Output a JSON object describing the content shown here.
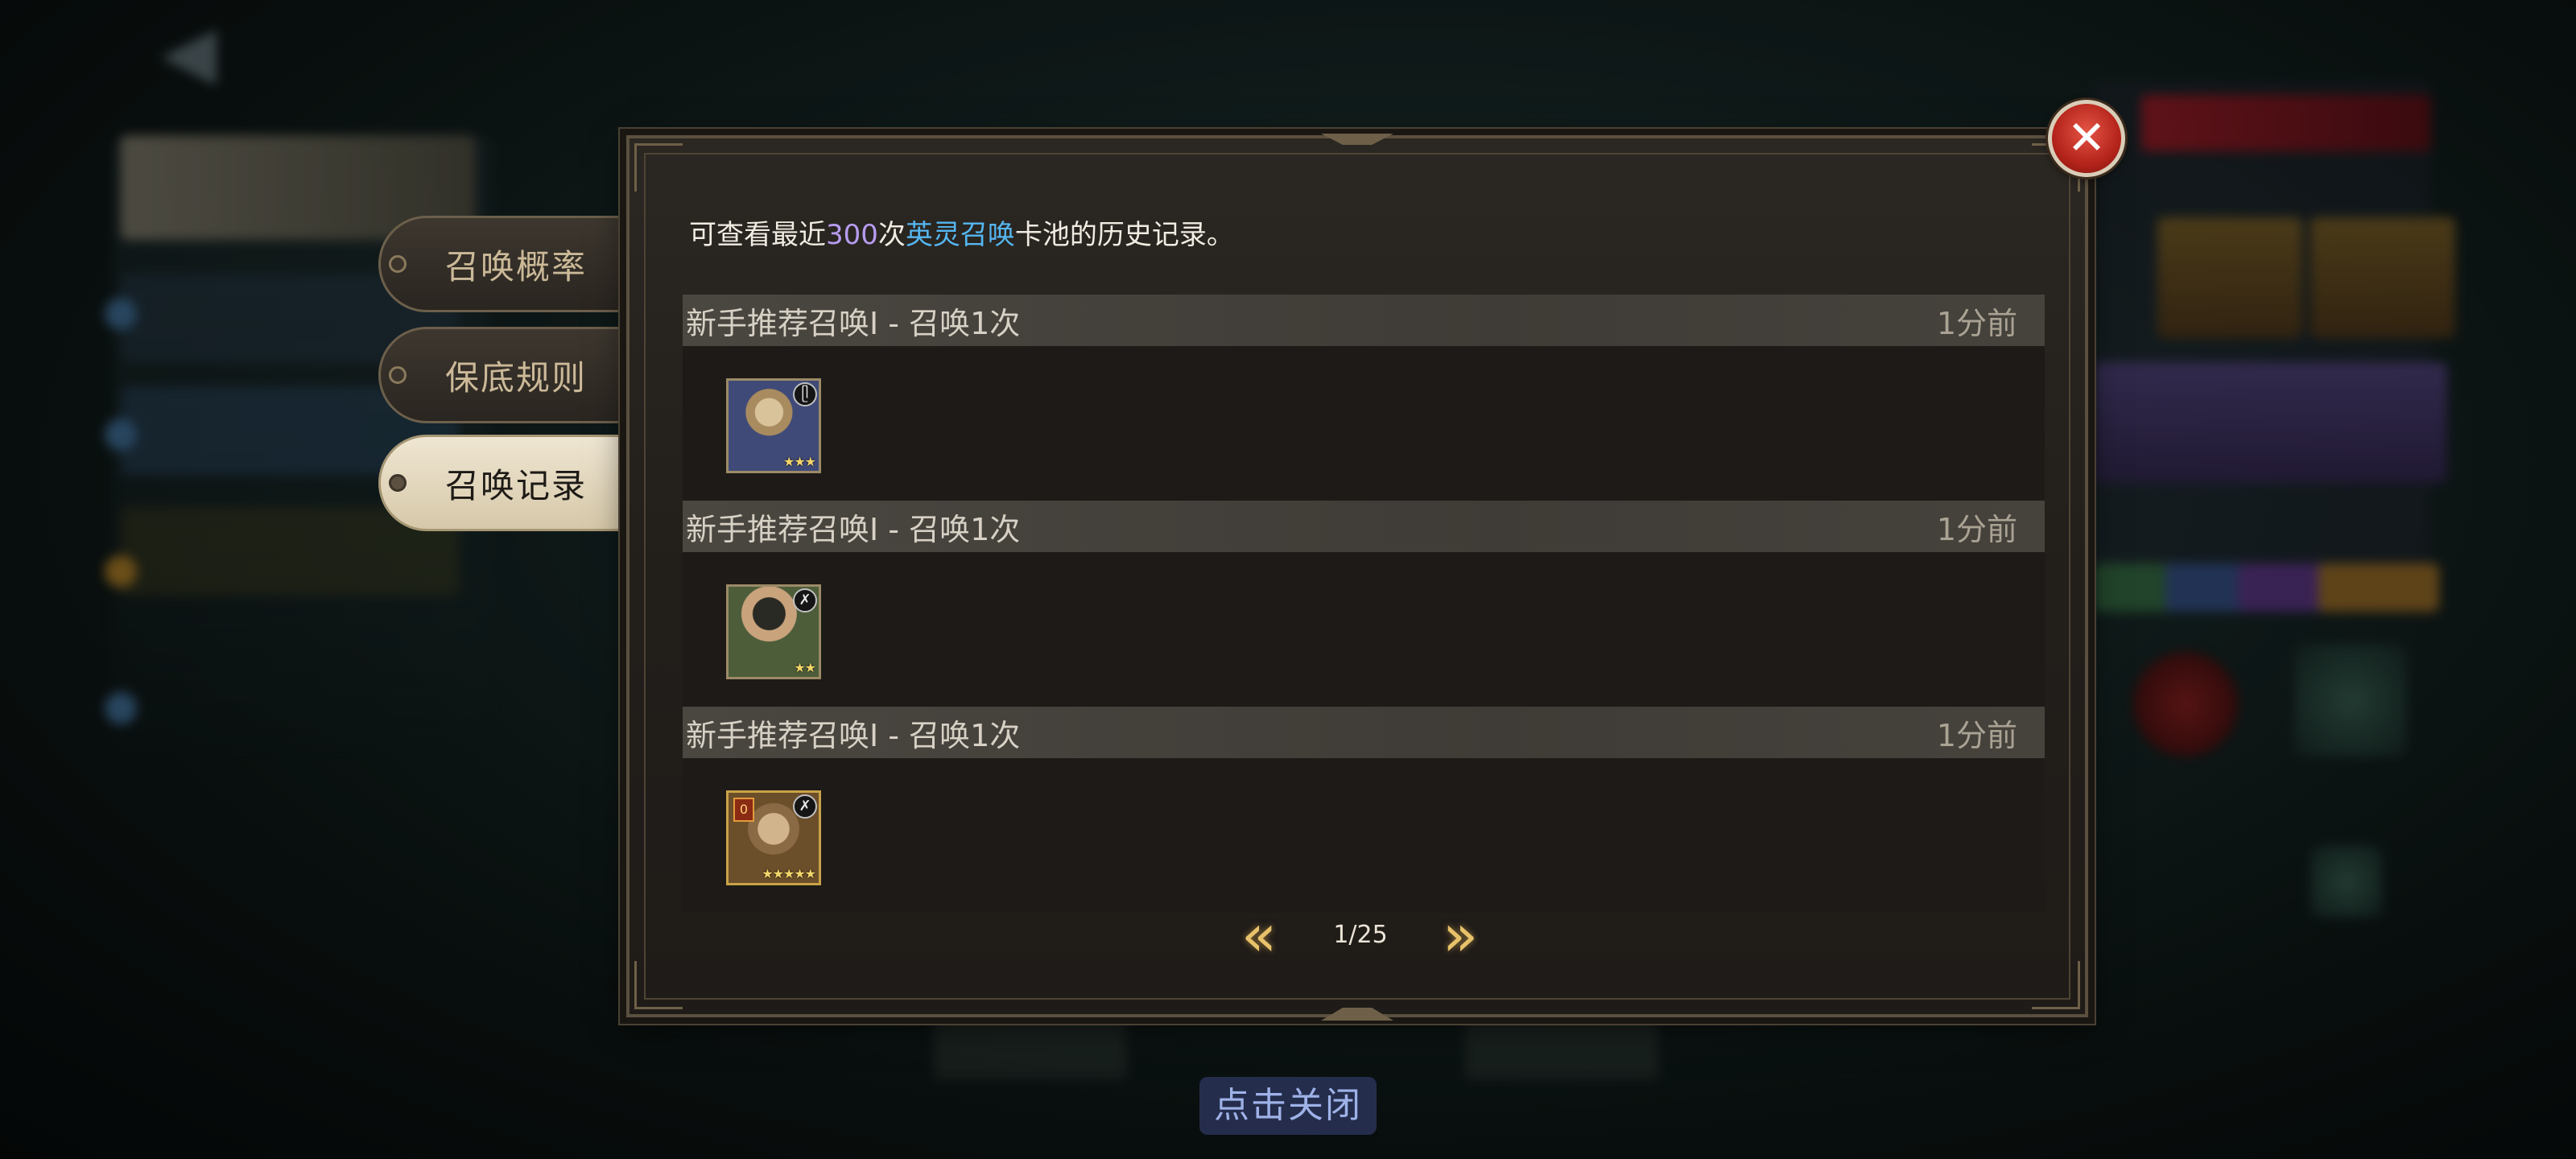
{
  "tabs": [
    {
      "label": "召唤概率",
      "active": false
    },
    {
      "label": "保底规则",
      "active": false
    },
    {
      "label": "召唤记录",
      "active": true
    }
  ],
  "dialog": {
    "desc_prefix": "可查看最近",
    "desc_count": "300",
    "desc_mid": "次",
    "desc_pool": "英灵召唤",
    "desc_suffix": "卡池的历史记录。"
  },
  "records": [
    {
      "title": "新手推荐召唤I - 召唤1次",
      "time": "1分前",
      "hero": {
        "stars": "★★★",
        "class_icon": "hands-icon",
        "badge": ""
      }
    },
    {
      "title": "新手推荐召唤I - 召唤1次",
      "time": "1分前",
      "hero": {
        "stars": "★★",
        "class_icon": "crossbow-icon",
        "badge": ""
      }
    },
    {
      "title": "新手推荐召唤I - 召唤1次",
      "time": "1分前",
      "hero": {
        "stars": "★★★★★",
        "class_icon": "crossbow-icon",
        "badge": "0"
      }
    }
  ],
  "pager": {
    "text": "1/25",
    "prev_icon": "double-chevron-left-icon",
    "next_icon": "double-chevron-right-icon"
  },
  "close_icon": "close-icon",
  "tap_to_close": "点击关闭",
  "colors": {
    "accent_count": "#b79cf0",
    "accent_pool": "#55b6f0",
    "pager_gold": "#e8c26a",
    "close_red": "#c42a20"
  }
}
